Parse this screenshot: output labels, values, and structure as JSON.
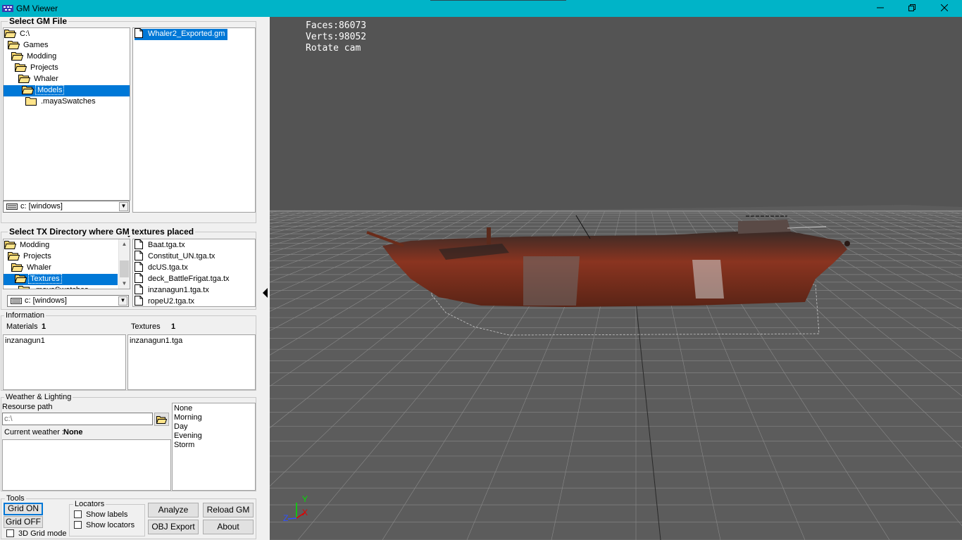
{
  "window": {
    "title": "GM Viewer"
  },
  "gm_file": {
    "section_title": "Select GM File",
    "tree": [
      {
        "label": "C:\\",
        "indent": 0,
        "selected": false,
        "open": true
      },
      {
        "label": "Games",
        "indent": 1,
        "selected": false,
        "open": true
      },
      {
        "label": "Modding",
        "indent": 2,
        "selected": false,
        "open": true
      },
      {
        "label": "Projects",
        "indent": 3,
        "selected": false,
        "open": true
      },
      {
        "label": "Whaler",
        "indent": 4,
        "selected": false,
        "open": true
      },
      {
        "label": "Models",
        "indent": 5,
        "selected": true,
        "open": true
      },
      {
        "label": ".mayaSwatches",
        "indent": 6,
        "selected": false,
        "open": false
      }
    ],
    "files": [
      {
        "label": "Whaler2_Exported.gm",
        "selected": true
      }
    ],
    "drive": "c: [windows]"
  },
  "tx_dir": {
    "section_title": "Select TX Directory where GM textures placed",
    "tree": [
      {
        "label": "Modding",
        "indent": 0,
        "selected": false,
        "open": true
      },
      {
        "label": "Projects",
        "indent": 1,
        "selected": false,
        "open": true
      },
      {
        "label": "Whaler",
        "indent": 2,
        "selected": false,
        "open": true
      },
      {
        "label": "Textures",
        "indent": 3,
        "selected": true,
        "open": true
      },
      {
        "label": ".mayaSwatches",
        "indent": 4,
        "selected": false,
        "open": false
      }
    ],
    "files": [
      {
        "label": "Baat.tga.tx"
      },
      {
        "label": "Constitut_UN.tga.tx"
      },
      {
        "label": "dcUS.tga.tx"
      },
      {
        "label": "deck_BattleFrigat.tga.tx"
      },
      {
        "label": "inzanagun1.tga.tx"
      },
      {
        "label": "ropeU2.tga.tx"
      }
    ],
    "drive": "c: [windows]"
  },
  "information": {
    "section_title": "Information",
    "materials_label": "Materials",
    "materials_count": "1",
    "textures_label": "Textures",
    "textures_count": "1",
    "materials": [
      "inzanagun1"
    ],
    "textures": [
      "inzanagun1.tga"
    ]
  },
  "weather": {
    "section_title": "Weather & Lighting",
    "resource_path_label": "Resourse path",
    "resource_path_value": "c:\\",
    "current_weather_label": "Current weather :",
    "current_weather_value": "None",
    "options": [
      "None",
      "Morning",
      "Day",
      "Evening",
      "Storm"
    ]
  },
  "tools": {
    "section_title": "Tools",
    "grid_on": "Grid ON",
    "grid_off": "Grid OFF",
    "grid_3d": "3D Grid mode",
    "locators_title": "Locators",
    "show_labels": "Show labels",
    "show_locators": "Show locators",
    "analyze": "Analyze",
    "reload_gm": "Reload GM",
    "obj_export": "OBJ Export",
    "about": "About"
  },
  "viewport": {
    "faces": "Faces:86073",
    "verts": "Verts:98052",
    "mode": "Rotate cam",
    "axes": {
      "y": "Y",
      "x": "X",
      "z": "Z"
    },
    "colors": {
      "background": "#545454",
      "grid": "#8a8a8a",
      "hull": "#7a2e1a"
    }
  },
  "colors": {
    "titlebar": "#00b4c8",
    "selection": "#0078d7"
  }
}
